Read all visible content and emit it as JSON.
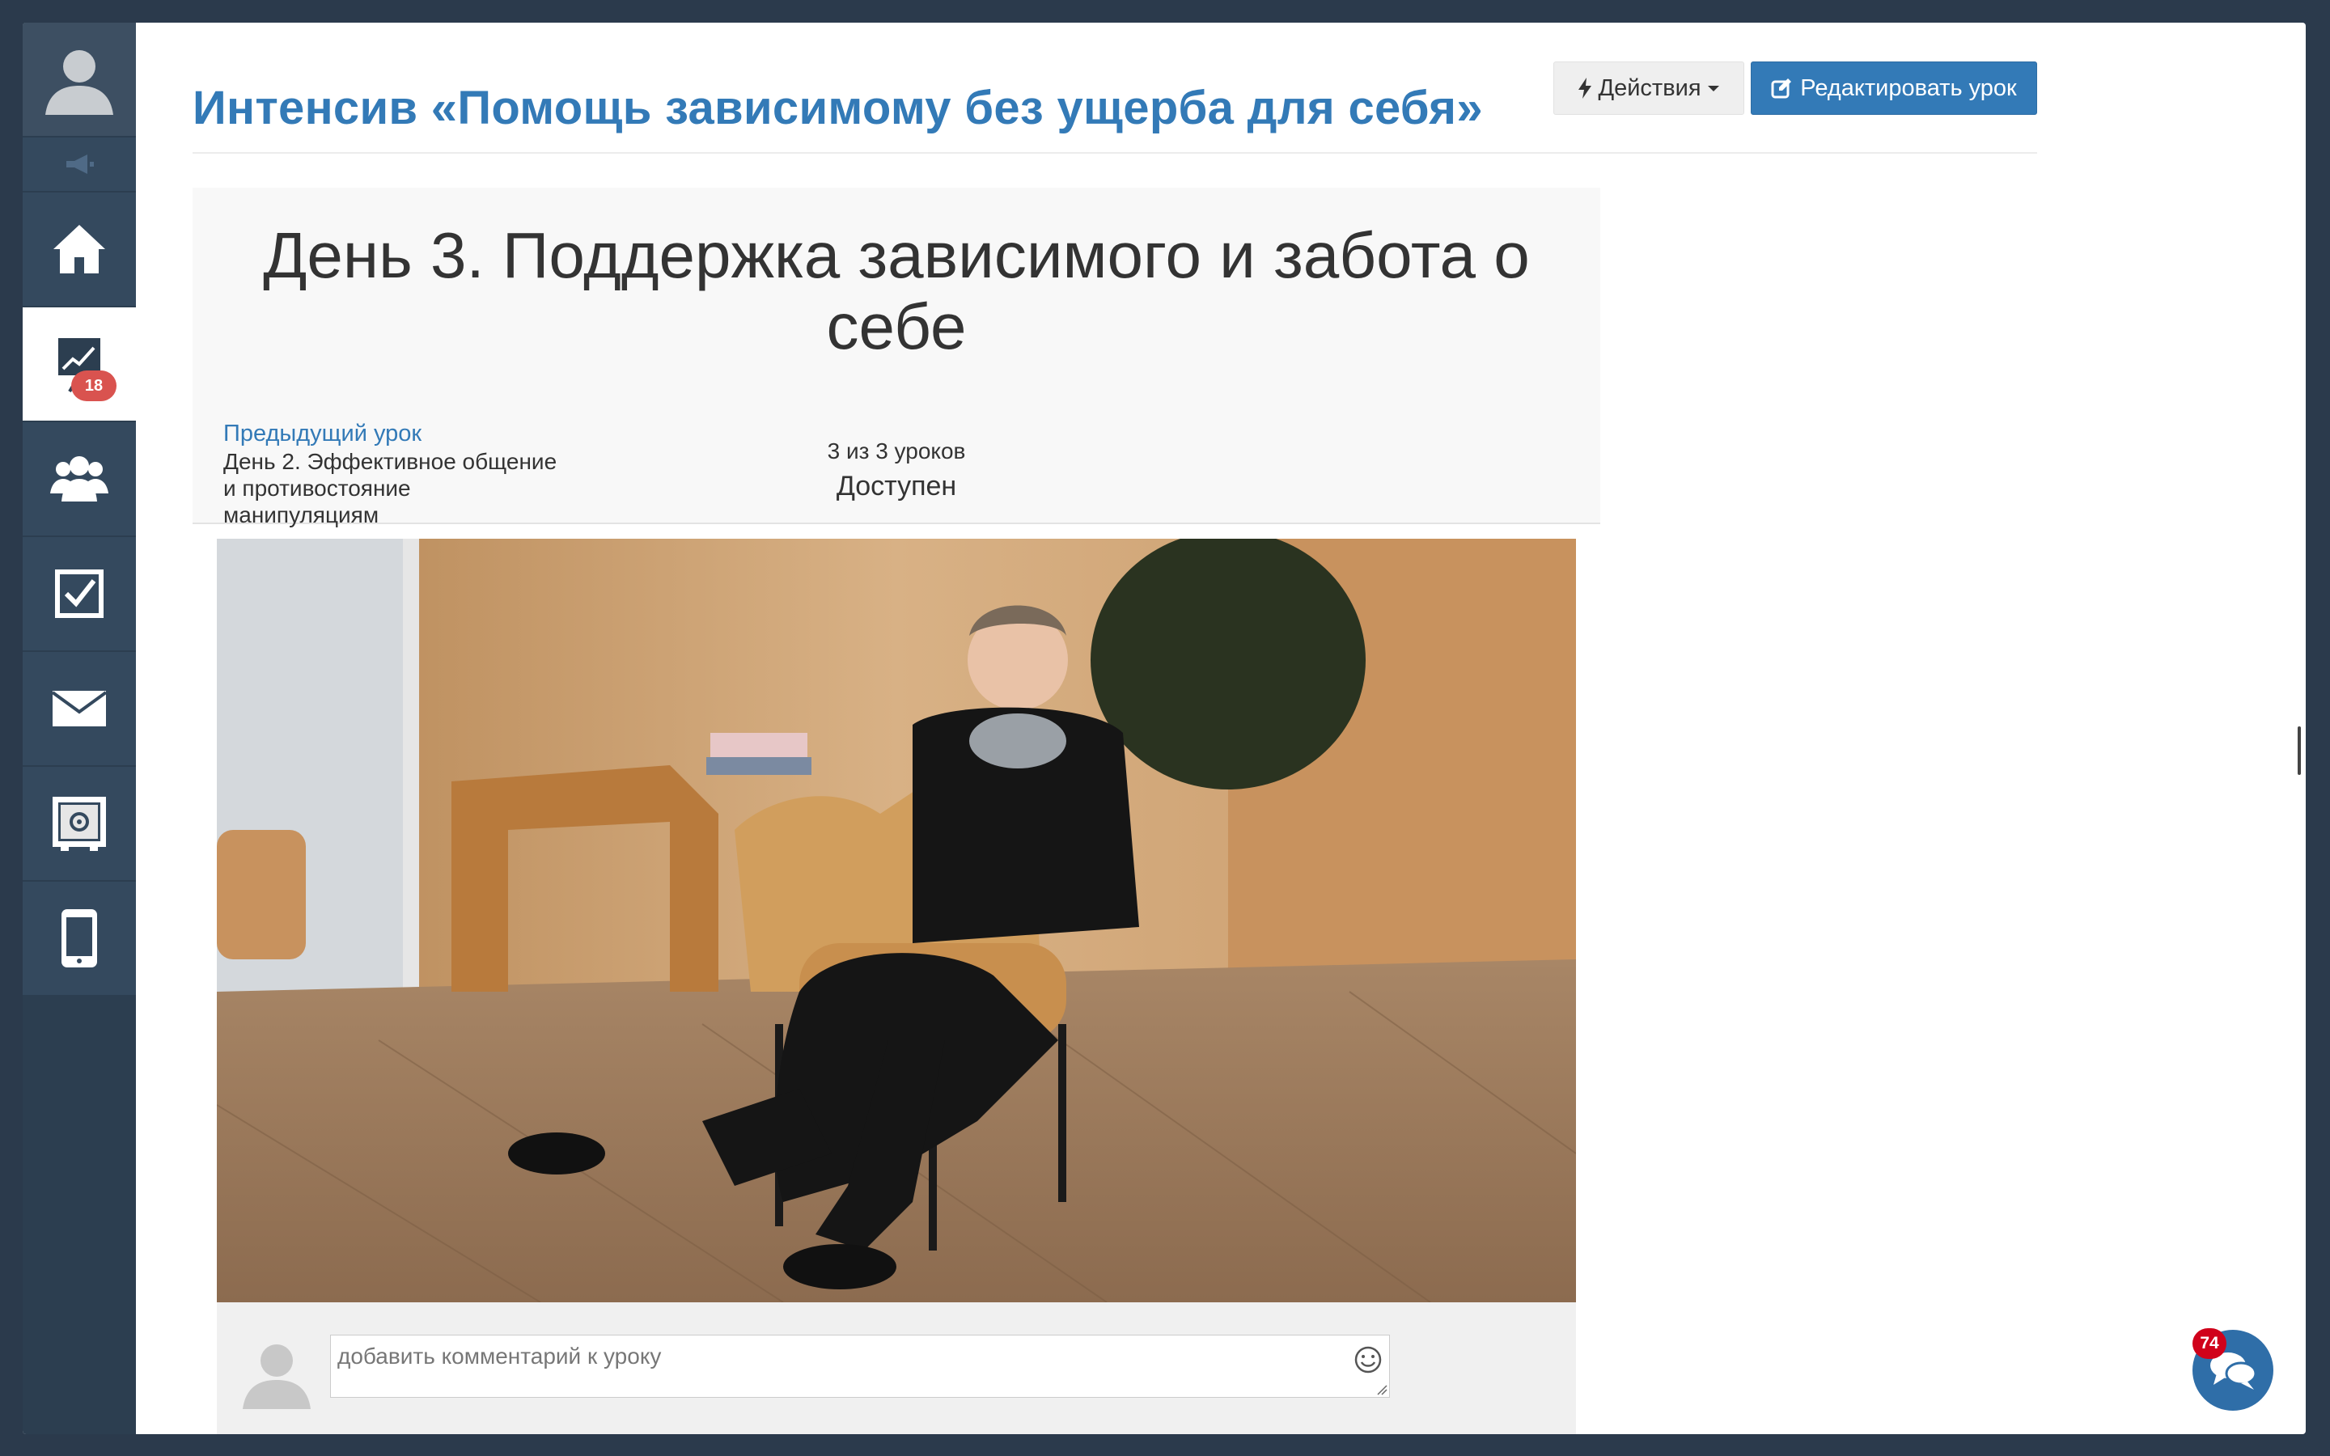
{
  "sidebar": {
    "items": [
      {
        "name": "profile",
        "icon": "user-avatar-icon"
      },
      {
        "name": "announcements",
        "icon": "megaphone-icon"
      },
      {
        "name": "home",
        "icon": "home-icon"
      },
      {
        "name": "training",
        "icon": "chart-board-icon",
        "badge": "18",
        "active": true
      },
      {
        "name": "users",
        "icon": "group-icon"
      },
      {
        "name": "tasks",
        "icon": "checkbox-icon"
      },
      {
        "name": "messages",
        "icon": "envelope-icon"
      },
      {
        "name": "safe",
        "icon": "safe-icon"
      },
      {
        "name": "mobile",
        "icon": "phone-icon"
      }
    ],
    "training_badge": "18"
  },
  "header": {
    "title": "Интенсив «Помощь зависимому без ущерба для себя»",
    "actions_label": "Действия",
    "edit_label": "Редактировать урок"
  },
  "lesson": {
    "title": "День 3. Поддержка зависимого и забота о себе",
    "prev_label": "Предыдущий урок",
    "prev_name": "День 2. Эффективное общение и противостояние манипуляциям",
    "progress": "3 из 3 уроков",
    "status": "Доступен"
  },
  "comments": {
    "placeholder": "добавить комментарий к уроку"
  },
  "chat": {
    "badge": "74"
  },
  "colors": {
    "sidebar_bg": "#2c3e50",
    "accent": "#337ab7",
    "badge_red": "#d9534f"
  }
}
